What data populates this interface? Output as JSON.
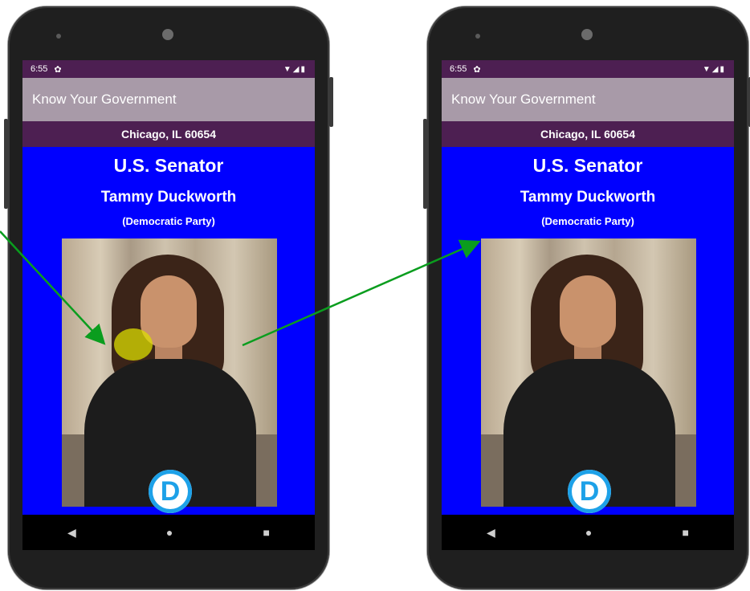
{
  "status_bar": {
    "time": "6:55",
    "settings_icon": "gear-icon",
    "right_icons": "▼◢▮"
  },
  "app_bar": {
    "title": "Know Your Government"
  },
  "location": {
    "text": "Chicago, IL 60654"
  },
  "official": {
    "office": "U.S. Senator",
    "name": "Tammy Duckworth",
    "party": "(Democratic Party)"
  },
  "party_logo": {
    "letter": "D",
    "color": "#1da1e8"
  },
  "nav": {
    "back": "◀",
    "home": "●",
    "recents": "■"
  },
  "colors": {
    "screen_bg": "#0000ff",
    "status_bar": "#4d1f52",
    "app_bar": "#a89aa8",
    "arrow": "#0a9d1e",
    "tap": "#dcdc00"
  }
}
